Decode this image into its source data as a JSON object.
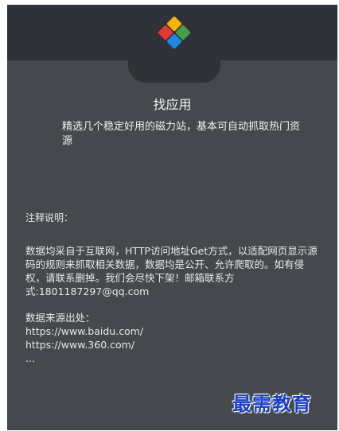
{
  "header": {
    "logo_icon": "four-color-diamond-logo-icon",
    "logo_colors": {
      "top": "#f4b400",
      "left": "#e53935",
      "right": "#43a047",
      "bottom": "#1e88e5"
    }
  },
  "app": {
    "title": "找应用",
    "description": "精选几个稳定好用的磁力站，基本可自动抓取热门资源"
  },
  "notes": {
    "heading": "注释说明：",
    "text": "数据均采自于互联网，HTTP访问地址Get方式，以适配网页显示源码的规则来抓取相关数据，数据均是公开、允许爬取的。如有侵权，请联系删掉。我们会尽快下架！邮箱联系方式:1801187297@qq.com"
  },
  "sources": {
    "heading": "数据来源出处：",
    "items": [
      "https://www.baidu.com/",
      "https://www.360.com/",
      "..."
    ]
  },
  "watermark": {
    "text": "最需教育"
  }
}
